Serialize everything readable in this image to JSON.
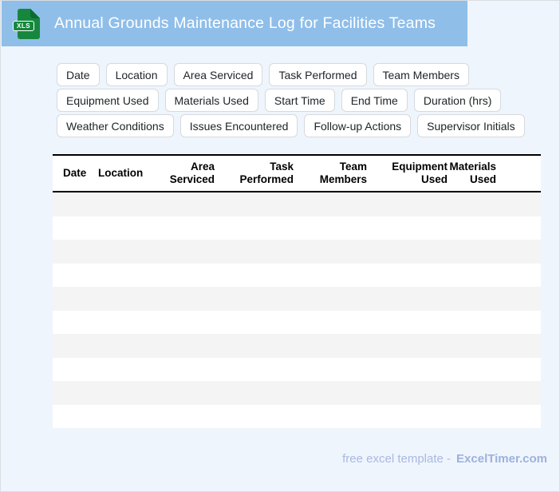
{
  "header": {
    "title": "Annual Grounds Maintenance Log for Facilities Teams",
    "file_icon_label": "XLS"
  },
  "chips": {
    "rows": [
      [
        "Date",
        "Location",
        "Area Serviced",
        "Task Performed",
        "Team Members"
      ],
      [
        "Equipment Used",
        "Materials Used",
        "Start Time",
        "End Time",
        "Duration (hrs)"
      ],
      [
        "Weather Conditions",
        "Issues Encountered",
        "Follow-up Actions",
        "Supervisor Initials"
      ]
    ]
  },
  "table": {
    "columns": [
      {
        "label": "Date"
      },
      {
        "label": "Location"
      },
      {
        "label": "Area\nServiced"
      },
      {
        "label": "Task\nPerformed"
      },
      {
        "label": "Team\nMembers"
      },
      {
        "label": "Equipment\nUsed"
      },
      {
        "label": "Materials\nUsed"
      }
    ],
    "row_count": 10
  },
  "footer": {
    "text": "free excel template -",
    "brand": "ExcelTimer.com"
  },
  "colors": {
    "banner_blue": "#8fbee9",
    "page_bg": "#eff5fc",
    "page_border": "#d9dde2",
    "icon_green": "#17873e",
    "fold_green": "#0c6b31",
    "chip_border": "#d6dade",
    "chip_text": "#212529",
    "stripe_gray": "#f5f4f5",
    "footer_text": "#a8b8e3",
    "footer_brand": "#9db1de"
  }
}
